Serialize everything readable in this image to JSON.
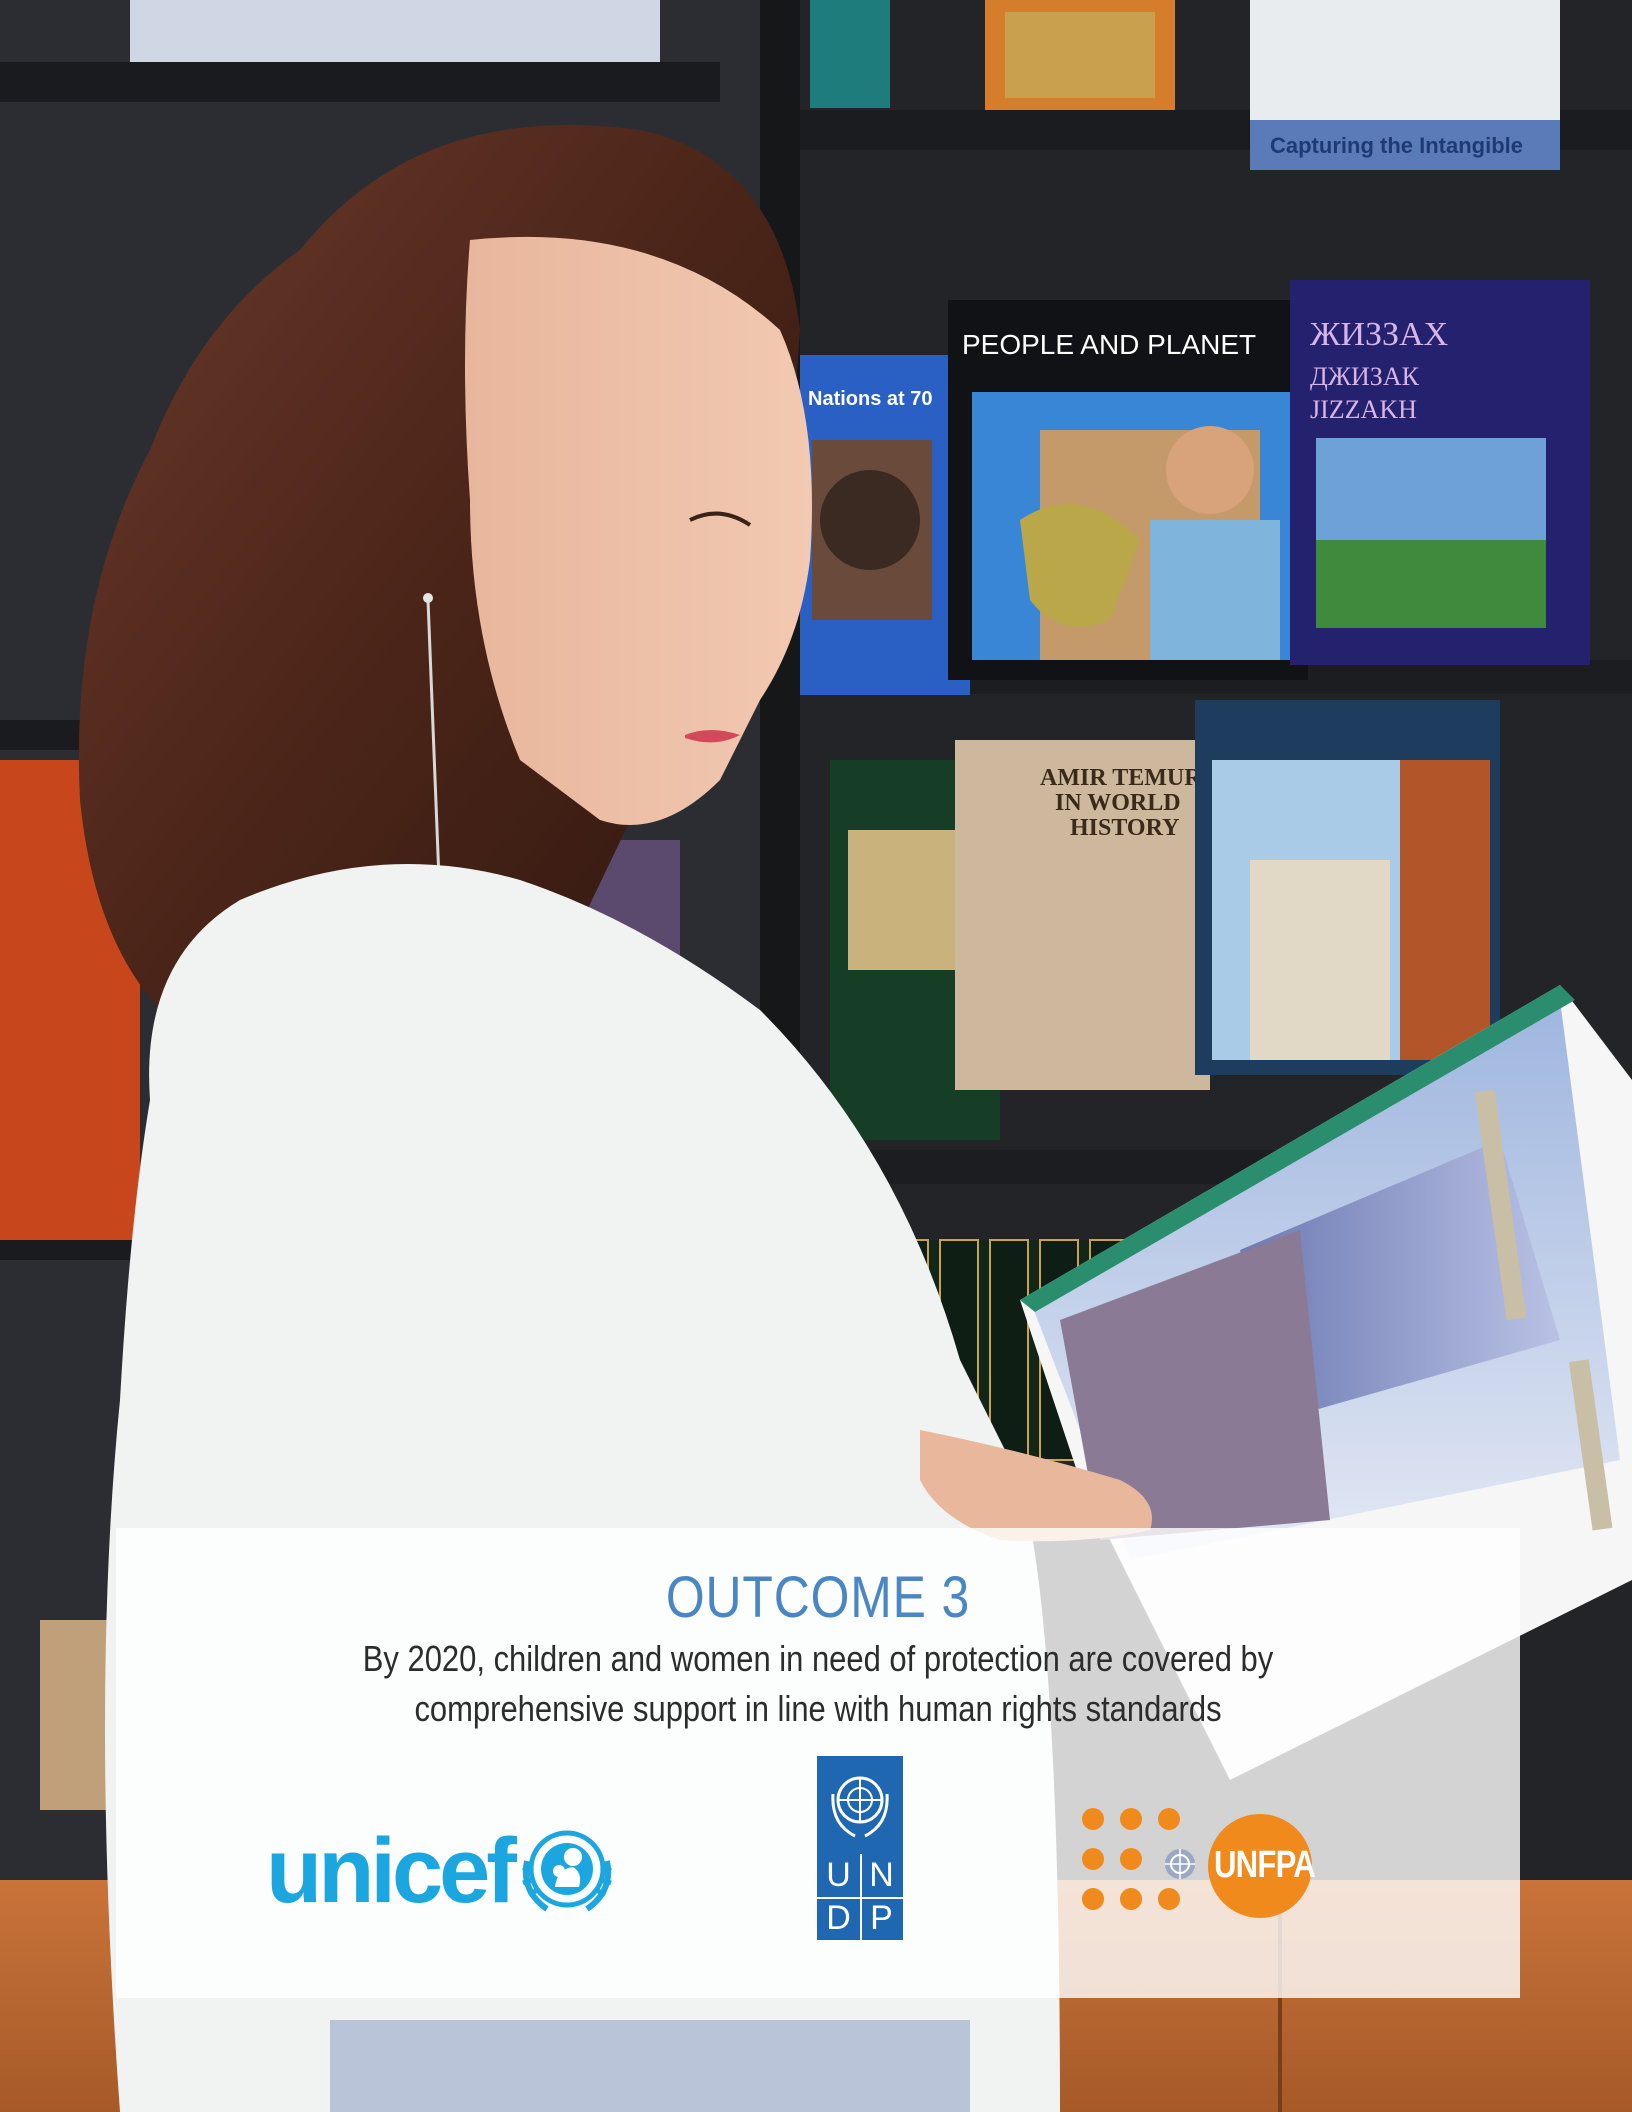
{
  "outcome": {
    "title": "OUTCOME 3",
    "line1": "By 2020, children and women in need of protection are covered by",
    "line2": "comprehensive support in line with human rights standards"
  },
  "logos": {
    "unicef": "unicef",
    "undp_letters": [
      "U",
      "N",
      "D",
      "P"
    ],
    "unfpa": "UNFPA"
  },
  "photo": {
    "book_people_planet": "PEOPLE AND PLANET",
    "book_jizzakh_1": "ЖИЗЗАХ",
    "book_jizzakh_2": "ДЖИЗАК",
    "book_jizzakh_3": "JIZZAKH",
    "book_amir_temur_1": "AMIR TEMUR",
    "book_amir_temur_2": "IN WORLD",
    "book_amir_temur_3": "HISTORY",
    "book_intangible": "Capturing the Intangible",
    "book_nations": "Nations at 70"
  },
  "colors": {
    "title_blue": "#4a86c4",
    "unicef_cyan": "#1ca6e0",
    "undp_blue": "#1f67b1",
    "unfpa_orange": "#f08a1c"
  }
}
